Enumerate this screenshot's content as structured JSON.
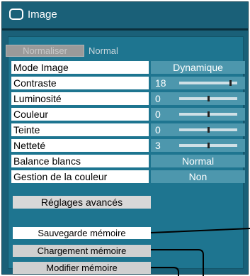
{
  "title": "Image",
  "normalize": {
    "label": "Normaliser",
    "value": "Normal"
  },
  "settings": [
    {
      "label": "Mode Image",
      "value": "Dynamique"
    },
    {
      "label": "Contraste",
      "value": "18",
      "level": 0.9
    },
    {
      "label": "Luminosité",
      "value": "0",
      "level": 0.5
    },
    {
      "label": "Couleur",
      "value": "0",
      "level": 0.5
    },
    {
      "label": "Teinte",
      "value": "0",
      "level": 0.5
    },
    {
      "label": "Netteté",
      "value": "3",
      "level": 0.5
    },
    {
      "label": "Balance blancs",
      "value": "Normal"
    },
    {
      "label": "Gestion de la couleur",
      "value": "Non"
    }
  ],
  "advanced_label": "Réglages avancés",
  "memory": {
    "save": "Sauvegarde mémoire",
    "load": "Chargement mémoire",
    "edit": "Modifier mémoire"
  },
  "colors": {
    "panel": "#1a6078",
    "value_bg": "#4d97ad",
    "selected": "#ffffff"
  }
}
